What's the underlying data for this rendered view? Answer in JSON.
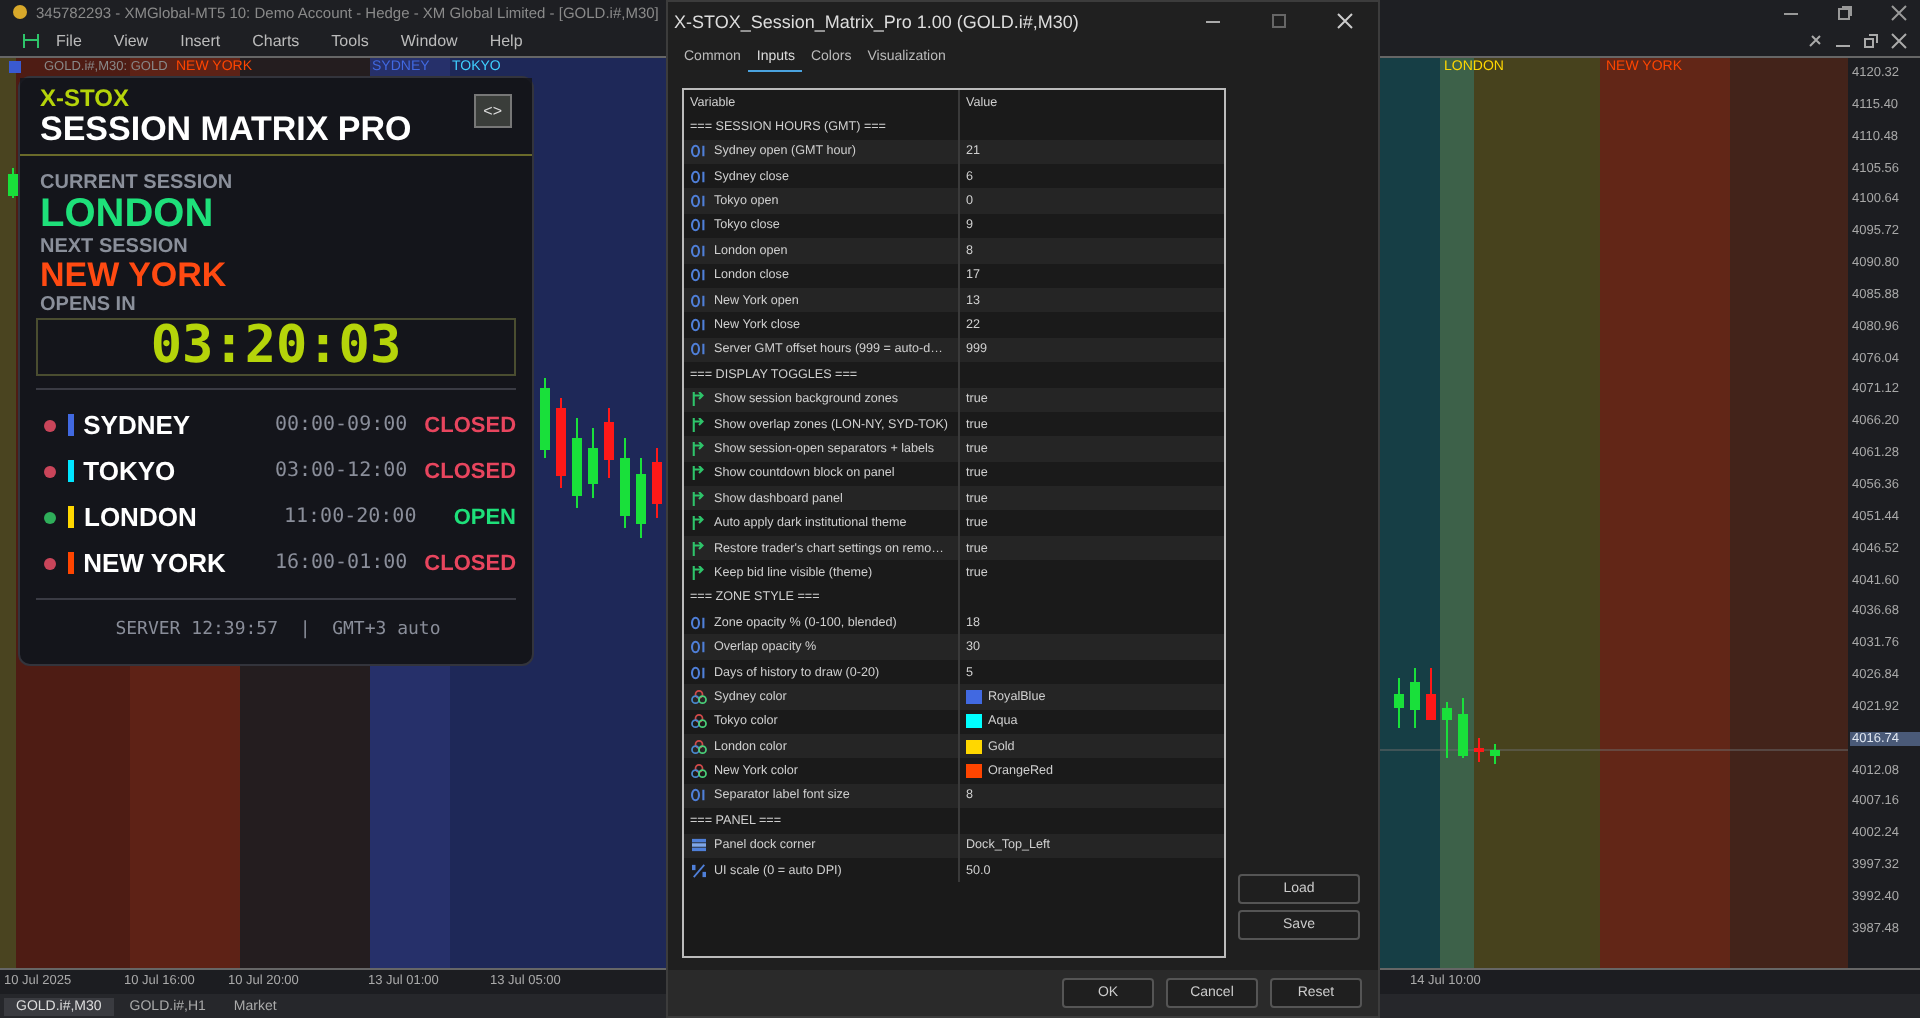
{
  "window": {
    "title": "345782293 - XMGlobal-MT5 10: Demo Account - Hedge - XM Global Limited - [GOLD.i#,M30]"
  },
  "menu": [
    "File",
    "View",
    "Insert",
    "Charts",
    "Tools",
    "Window",
    "Help"
  ],
  "chart": {
    "symbol": "GOLD.i#,M30: GOLD",
    "session_labels": [
      {
        "text": "NEW YORK",
        "color": "#ff4500"
      },
      {
        "text": "SYDNEY",
        "color": "#4169e1"
      },
      {
        "text": "TOKYO",
        "color": "#3fd0ff"
      },
      {
        "text": "LONDON",
        "color": "#ffd700"
      },
      {
        "text": "NEW YORK",
        "color": "#ff4500"
      }
    ],
    "price_axis": [
      {
        "label": "4120.32",
        "current": false
      },
      {
        "label": "4115.40",
        "current": false
      },
      {
        "label": "4110.48",
        "current": false
      },
      {
        "label": "4105.56",
        "current": false
      },
      {
        "label": "4100.64",
        "current": false
      },
      {
        "label": "4095.72",
        "current": false
      },
      {
        "label": "4090.80",
        "current": false
      },
      {
        "label": "4085.88",
        "current": false
      },
      {
        "label": "4080.96",
        "current": false
      },
      {
        "label": "4076.04",
        "current": false
      },
      {
        "label": "4071.12",
        "current": false
      },
      {
        "label": "4066.20",
        "current": false
      },
      {
        "label": "4061.28",
        "current": false
      },
      {
        "label": "4056.36",
        "current": false
      },
      {
        "label": "4051.44",
        "current": false
      },
      {
        "label": "4046.52",
        "current": false
      },
      {
        "label": "4041.60",
        "current": false
      },
      {
        "label": "4036.68",
        "current": false
      },
      {
        "label": "4031.76",
        "current": false
      },
      {
        "label": "4026.84",
        "current": false
      },
      {
        "label": "4021.92",
        "current": false
      },
      {
        "label": "4016.74",
        "current": true
      },
      {
        "label": "4012.08",
        "current": false
      },
      {
        "label": "4007.16",
        "current": false
      },
      {
        "label": "4002.24",
        "current": false
      },
      {
        "label": "3997.32",
        "current": false
      },
      {
        "label": "3992.40",
        "current": false
      },
      {
        "label": "3987.48",
        "current": false
      }
    ],
    "time_axis": [
      "10 Jul 2025",
      "10 Jul 16:00",
      "10 Jul 20:00",
      "13 Jul 01:00",
      "13 Jul 05:00",
      "14 Jul 10:00"
    ]
  },
  "panel": {
    "brand": "X-STOX",
    "title": "SESSION MATRIX PRO",
    "toggle": "<>",
    "current_label": "CURRENT SESSION",
    "current": "LONDON",
    "next_label": "NEXT SESSION",
    "next": "NEW YORK",
    "opens_label": "OPENS IN",
    "countdown": "03:20:03",
    "sessions": [
      {
        "name": "SYDNEY",
        "hours": "00:00-09:00",
        "status": "CLOSED",
        "open": false,
        "color": "#4169e1"
      },
      {
        "name": "TOKYO",
        "hours": "03:00-12:00",
        "status": "CLOSED",
        "open": false,
        "color": "#00e5ff"
      },
      {
        "name": "LONDON",
        "hours": "11:00-20:00",
        "status": "OPEN",
        "open": true,
        "color": "#ffd700"
      },
      {
        "name": "NEW YORK",
        "hours": "16:00-01:00",
        "status": "CLOSED",
        "open": false,
        "color": "#ff4500"
      }
    ],
    "footer": "SERVER 12:39:57  |  GMT+3 auto"
  },
  "dialog": {
    "title": "X-STOX_Session_Matrix_Pro 1.00 (GOLD.i#,M30)",
    "tabs": [
      {
        "label": "Common",
        "selected": false
      },
      {
        "label": "Inputs",
        "selected": true
      },
      {
        "label": "Colors",
        "selected": false
      },
      {
        "label": "Visualization",
        "selected": false
      }
    ],
    "columns": [
      "Variable",
      "Value"
    ],
    "rows": [
      {
        "kind": "section",
        "name": "=== SESSION HOURS (GMT) ==="
      },
      {
        "kind": "int",
        "name": "Sydney open (GMT hour)",
        "value": "21"
      },
      {
        "kind": "int",
        "name": "Sydney close",
        "value": "6"
      },
      {
        "kind": "int",
        "name": "Tokyo open",
        "value": "0"
      },
      {
        "kind": "int",
        "name": "Tokyo close",
        "value": "9"
      },
      {
        "kind": "int",
        "name": "London open",
        "value": "8"
      },
      {
        "kind": "int",
        "name": "London close",
        "value": "17"
      },
      {
        "kind": "int",
        "name": "New York open",
        "value": "13"
      },
      {
        "kind": "int",
        "name": "New York close",
        "value": "22"
      },
      {
        "kind": "int",
        "name": "Server GMT offset hours (999 = auto-d…",
        "value": "999"
      },
      {
        "kind": "section",
        "name": "=== DISPLAY TOGGLES ==="
      },
      {
        "kind": "bool",
        "name": "Show session background zones",
        "value": "true"
      },
      {
        "kind": "bool",
        "name": "Show overlap zones (LON-NY, SYD-TOK)",
        "value": "true"
      },
      {
        "kind": "bool",
        "name": "Show session-open separators + labels",
        "value": "true"
      },
      {
        "kind": "bool",
        "name": "Show countdown block on panel",
        "value": "true"
      },
      {
        "kind": "bool",
        "name": "Show dashboard panel",
        "value": "true"
      },
      {
        "kind": "bool",
        "name": "Auto apply dark institutional theme",
        "value": "true"
      },
      {
        "kind": "bool",
        "name": "Restore trader's chart settings on remo…",
        "value": "true"
      },
      {
        "kind": "bool",
        "name": "Keep bid line visible (theme)",
        "value": "true"
      },
      {
        "kind": "section",
        "name": "=== ZONE STYLE ==="
      },
      {
        "kind": "int",
        "name": "Zone opacity % (0-100, blended)",
        "value": "18"
      },
      {
        "kind": "int",
        "name": "Overlap opacity %",
        "value": "30"
      },
      {
        "kind": "int",
        "name": "Days of history to draw (0-20)",
        "value": "5"
      },
      {
        "kind": "color",
        "name": "Sydney color",
        "value": "RoyalBlue",
        "color": "#4169e1"
      },
      {
        "kind": "color",
        "name": "Tokyo color",
        "value": "Aqua",
        "color": "#00ffff"
      },
      {
        "kind": "color",
        "name": "London color",
        "value": "Gold",
        "color": "#ffd700"
      },
      {
        "kind": "color",
        "name": "New York color",
        "value": "OrangeRed",
        "color": "#ff4500"
      },
      {
        "kind": "int",
        "name": "Separator label font size",
        "value": "8"
      },
      {
        "kind": "section",
        "name": "=== PANEL ==="
      },
      {
        "kind": "enum",
        "name": "Panel dock corner",
        "value": "Dock_Top_Left"
      },
      {
        "kind": "double",
        "name": "UI scale (0 = auto DPI)",
        "value": "50.0"
      }
    ],
    "side_buttons": [
      "Load",
      "Save"
    ],
    "buttons": [
      "OK",
      "Cancel",
      "Reset"
    ]
  },
  "bottom_tabs": [
    {
      "label": "GOLD.i#,M30",
      "selected": true
    },
    {
      "label": "GOLD.i#,H1",
      "selected": false
    },
    {
      "label": "Market",
      "selected": false
    }
  ]
}
